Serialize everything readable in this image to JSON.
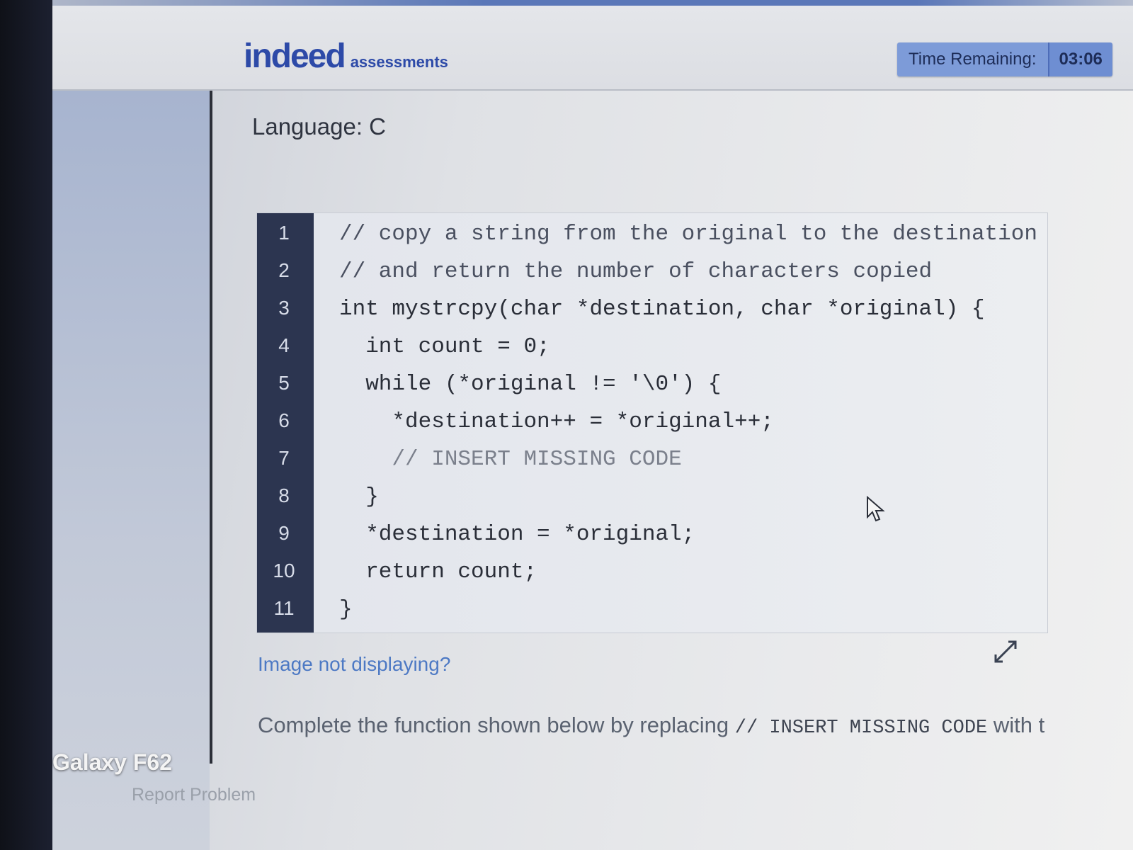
{
  "header": {
    "logo_word": "indeed",
    "logo_sub": "assessments",
    "timer_label": "Time Remaining:",
    "timer_value": "03:06"
  },
  "question": {
    "language": "Language: C",
    "code_lines": [
      "// copy a string from the original to the destination",
      "// and return the number of characters copied",
      "int mystrcpy(char *destination, char *original) {",
      "  int count = 0;",
      "  while (*original != '\\0') {",
      "    *destination++ = *original++;",
      "    // INSERT MISSING CODE",
      "  }",
      "  *destination = *original;",
      "  return count;",
      "}"
    ],
    "line_numbers": [
      "1",
      "2",
      "3",
      "4",
      "5",
      "6",
      "7",
      "8",
      "9",
      "10",
      "11"
    ],
    "image_link": "Image not displaying?",
    "instruction_prefix": "Complete the function shown below by replacing ",
    "instruction_code": "// INSERT MISSING CODE",
    "instruction_suffix": " with t"
  },
  "footer": {
    "report": "Report Problem"
  },
  "watermark": "Galaxy F62",
  "colors": {
    "brand": "#2d4aa8",
    "timer": "#7d9bd8",
    "gutter": "#2c3550",
    "keyword": "#a03a4c",
    "link": "#4d79c4"
  },
  "icons": [
    "expand-icon",
    "mouse-cursor-icon"
  ]
}
